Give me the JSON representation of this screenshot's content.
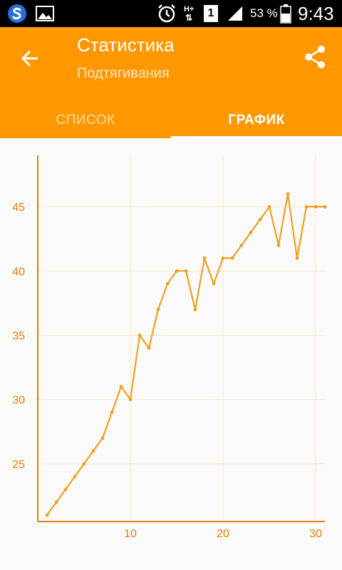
{
  "status_bar": {
    "battery_percent": "53 %",
    "time": "9:43",
    "network_type": "H+",
    "sim_slot": "1",
    "icons": [
      "app-s-icon",
      "image-icon",
      "alarm-icon",
      "network-arrows-icon",
      "sim-icon",
      "signal-icon",
      "battery-icon"
    ]
  },
  "header": {
    "title": "Статистика",
    "subtitle": "Подтягивания",
    "back_icon": "arrow-back-icon",
    "share_icon": "share-icon"
  },
  "tabs": [
    {
      "label": "СПИСОК",
      "active": false
    },
    {
      "label": "ГРАФИК",
      "active": true
    }
  ],
  "colors": {
    "accent": "#ff9800",
    "line": "#f0a020",
    "axis": "#e67e00",
    "grid": "#fde6c4",
    "background": "#fafafa"
  },
  "chart_data": {
    "type": "line",
    "title": "",
    "xlabel": "",
    "ylabel": "",
    "x": [
      1,
      2,
      3,
      4,
      5,
      6,
      7,
      8,
      9,
      10,
      11,
      12,
      13,
      14,
      15,
      16,
      17,
      18,
      19,
      20,
      21,
      22,
      23,
      24,
      25,
      26,
      27,
      28,
      29,
      30,
      31
    ],
    "values": [
      21,
      22,
      23,
      24,
      25,
      26,
      27,
      29,
      31,
      30,
      35,
      34,
      37,
      39,
      40,
      40,
      37,
      41,
      39,
      41,
      41,
      42,
      43,
      44,
      45,
      42,
      46,
      41,
      45,
      45,
      45
    ],
    "xlim": [
      0,
      31
    ],
    "ylim": [
      20.5,
      49
    ],
    "x_ticks": [
      10,
      20,
      30
    ],
    "y_ticks": [
      25,
      30,
      35,
      40,
      45
    ],
    "grid": true,
    "legend": false
  }
}
